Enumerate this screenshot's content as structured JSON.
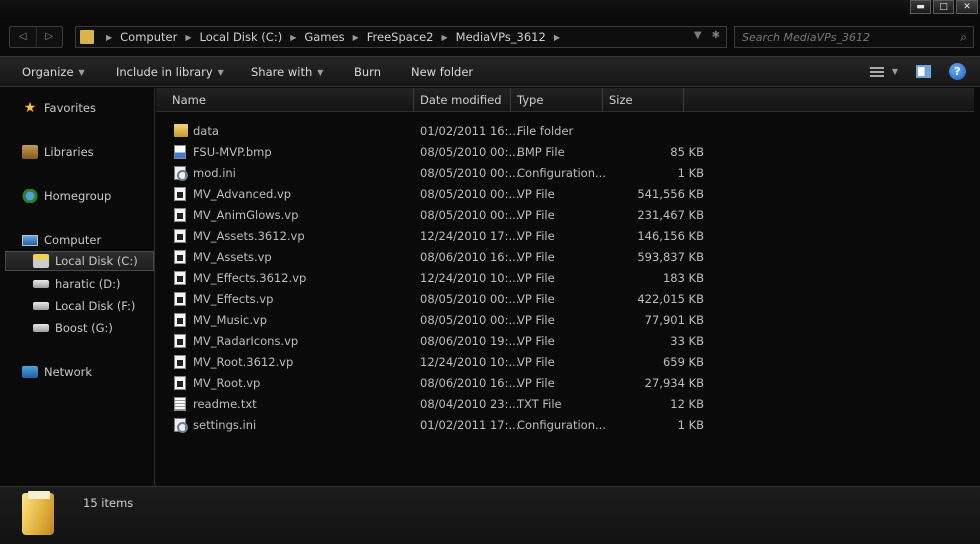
{
  "window": {
    "buttons": {
      "minimize": "▬",
      "maximize": "□",
      "close": "✕"
    }
  },
  "nav": {
    "back": "◁",
    "forward": "▷"
  },
  "address": {
    "crumbs": [
      "Computer",
      "Local Disk (C:)",
      "Games",
      "FreeSpace2",
      "MediaVPs_3612"
    ]
  },
  "search": {
    "placeholder": "Search MediaVPs_3612"
  },
  "commands": {
    "organize": "Organize",
    "include_in_library": "Include in library",
    "share_with": "Share with",
    "burn": "Burn",
    "new_folder": "New folder"
  },
  "sidebar": {
    "favorites": "Favorites",
    "libraries": "Libraries",
    "homegroup": "Homegroup",
    "computer": "Computer",
    "drives": [
      {
        "label": "Local Disk (C:)",
        "selected": true
      },
      {
        "label": "haratic (D:)"
      },
      {
        "label": "Local Disk (F:)"
      },
      {
        "label": "Boost (G:)"
      }
    ],
    "network": "Network"
  },
  "columns": {
    "name": "Name",
    "date": "Date modified",
    "type": "Type",
    "size": "Size"
  },
  "files": [
    {
      "icon": "folder",
      "name": "data",
      "date": "01/02/2011 16:...",
      "type": "File folder",
      "size": ""
    },
    {
      "icon": "bmp",
      "name": "FSU-MVP.bmp",
      "date": "08/05/2010 00:...",
      "type": "BMP File",
      "size": "85 KB"
    },
    {
      "icon": "ini",
      "name": "mod.ini",
      "date": "08/05/2010 00:...",
      "type": "Configuration...",
      "size": "1 KB"
    },
    {
      "icon": "vp",
      "name": "MV_Advanced.vp",
      "date": "08/05/2010 00:...",
      "type": "VP File",
      "size": "541,556 KB"
    },
    {
      "icon": "vp",
      "name": "MV_AnimGlows.vp",
      "date": "08/05/2010 00:...",
      "type": "VP File",
      "size": "231,467 KB"
    },
    {
      "icon": "vp",
      "name": "MV_Assets.3612.vp",
      "date": "12/24/2010 17:...",
      "type": "VP File",
      "size": "146,156 KB"
    },
    {
      "icon": "vp",
      "name": "MV_Assets.vp",
      "date": "08/06/2010 16:...",
      "type": "VP File",
      "size": "593,837 KB"
    },
    {
      "icon": "vp",
      "name": "MV_Effects.3612.vp",
      "date": "12/24/2010 10:...",
      "type": "VP File",
      "size": "183 KB"
    },
    {
      "icon": "vp",
      "name": "MV_Effects.vp",
      "date": "08/05/2010 00:...",
      "type": "VP File",
      "size": "422,015 KB"
    },
    {
      "icon": "vp",
      "name": "MV_Music.vp",
      "date": "08/05/2010 00:...",
      "type": "VP File",
      "size": "77,901 KB"
    },
    {
      "icon": "vp",
      "name": "MV_RadarIcons.vp",
      "date": "08/06/2010 19:...",
      "type": "VP File",
      "size": "33 KB"
    },
    {
      "icon": "vp",
      "name": "MV_Root.3612.vp",
      "date": "12/24/2010 10:...",
      "type": "VP File",
      "size": "659 KB"
    },
    {
      "icon": "vp",
      "name": "MV_Root.vp",
      "date": "08/06/2010 16:...",
      "type": "VP File",
      "size": "27,934 KB"
    },
    {
      "icon": "txt",
      "name": "readme.txt",
      "date": "08/04/2010 23:...",
      "type": "TXT File",
      "size": "12 KB"
    },
    {
      "icon": "ini",
      "name": "settings.ini",
      "date": "01/02/2011 17:...",
      "type": "Configuration...",
      "size": "1 KB"
    }
  ],
  "status": {
    "item_count": "15 items"
  }
}
